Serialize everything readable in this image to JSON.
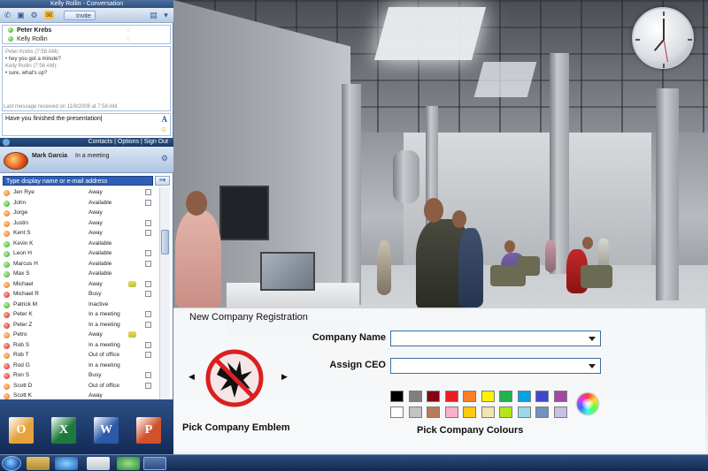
{
  "conversation": {
    "window_title": "Kelly Rollin - Conversation",
    "invite_label": "Invite",
    "participants": [
      {
        "name": "Peter Krebs",
        "status": "available"
      },
      {
        "name": "Kelly Rollin",
        "status": "available"
      }
    ],
    "history": [
      {
        "meta": "Peter Krebs (7:58 AM):",
        "text": "hey you got a minute?"
      },
      {
        "meta": "Kelly Rollin (7:58 AM):",
        "text": "sure, what's up?"
      }
    ],
    "last_message": "Last message received on 11/8/2006 at 7:58 AM.",
    "compose_text": "Have you finished the presentation"
  },
  "contacts_bar": {
    "links": "Contacts | Options | Sign Out"
  },
  "me": {
    "name": "Mark Garcia",
    "status": "In a meeting"
  },
  "search": {
    "placeholder": "Type display name or e-mail address"
  },
  "contacts": [
    {
      "name": "Jen Rye",
      "status": "Away",
      "color": "o"
    },
    {
      "name": "John",
      "status": "Available",
      "color": "g"
    },
    {
      "name": "Jorge",
      "status": "Away",
      "color": "o"
    },
    {
      "name": "Justin",
      "status": "Away",
      "color": "o"
    },
    {
      "name": "Kent S",
      "status": "Away",
      "color": "o"
    },
    {
      "name": "Kevin K",
      "status": "Available",
      "color": "g"
    },
    {
      "name": "Leon H",
      "status": "Available",
      "color": "g"
    },
    {
      "name": "Marcus H",
      "status": "Available",
      "color": "g"
    },
    {
      "name": "Max S",
      "status": "Available",
      "color": "g"
    },
    {
      "name": "Michael",
      "status": "Away",
      "color": "o"
    },
    {
      "name": "Michael R",
      "status": "Busy",
      "color": "r"
    },
    {
      "name": "Patrick M",
      "status": "Inactive",
      "color": "g"
    },
    {
      "name": "Peter K",
      "status": "In a meeting",
      "color": "r"
    },
    {
      "name": "Peter Z",
      "status": "In a meeting",
      "color": "r"
    },
    {
      "name": "Petro",
      "status": "Away",
      "color": "o"
    },
    {
      "name": "Rob S",
      "status": "In a meeting",
      "color": "r"
    },
    {
      "name": "Rob T",
      "status": "Out of office",
      "color": "o"
    },
    {
      "name": "Rod G",
      "status": "In a meeting",
      "color": "r"
    },
    {
      "name": "Ron S",
      "status": "Busy",
      "color": "r"
    },
    {
      "name": "Scott D",
      "status": "Out of office",
      "color": "o"
    },
    {
      "name": "Scott K",
      "status": "Away",
      "color": "o"
    }
  ],
  "dock_apps": [
    {
      "name": "Outlook",
      "letter": "O",
      "color": "#e6a23c"
    },
    {
      "name": "Excel",
      "letter": "X",
      "color": "#1e7a3c"
    },
    {
      "name": "Word",
      "letter": "W",
      "color": "#2a5aa8"
    },
    {
      "name": "PowerPoint",
      "letter": "P",
      "color": "#d0512a"
    }
  ],
  "registration": {
    "title": "New Company Registration",
    "company_name_label": "Company Name",
    "company_name_value": "",
    "assign_ceo_label": "Assign CEO",
    "assign_ceo_value": "",
    "emblem_caption": "Pick Company Emblem",
    "colours_caption": "Pick Company Colours",
    "prev_arrow": "◀",
    "next_arrow": "▶",
    "palette_row1": [
      "#000000",
      "#7f7f7f",
      "#880015",
      "#ed1c24",
      "#ff7f27",
      "#fff200",
      "#22b14c",
      "#00a2e8",
      "#3f48cc",
      "#a349a4"
    ],
    "palette_row2": [
      "#ffffff",
      "#c3c3c3",
      "#b97a57",
      "#ffaec9",
      "#ffc90e",
      "#efe4b0",
      "#b5e61d",
      "#99d9ea",
      "#7092be",
      "#c8bfe7"
    ]
  }
}
